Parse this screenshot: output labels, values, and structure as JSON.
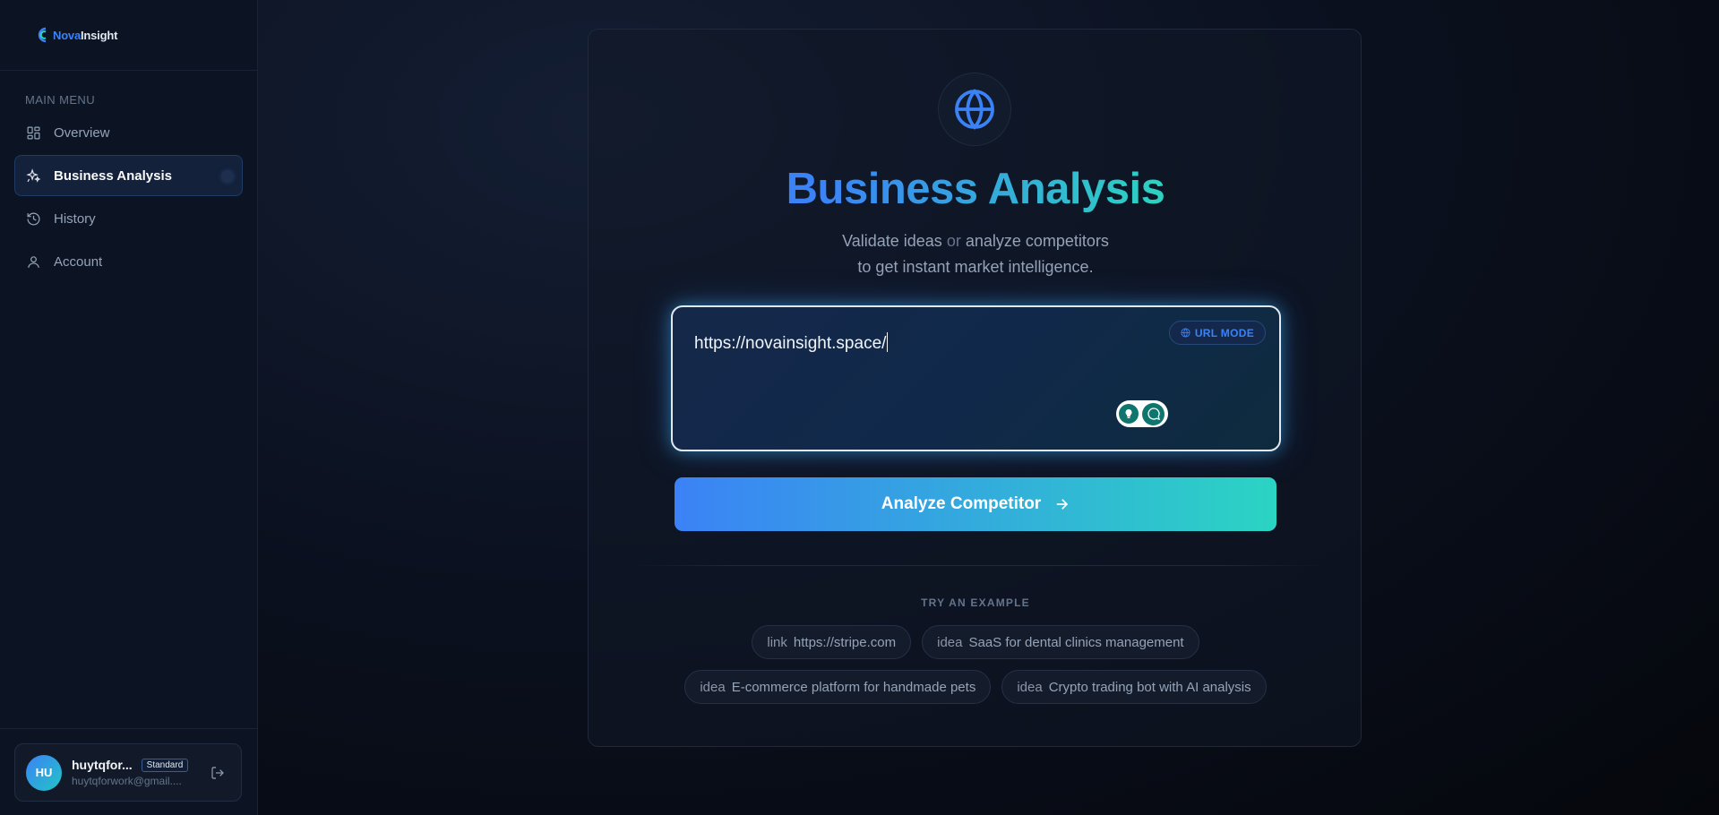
{
  "brand": {
    "name_part1": "Nova",
    "name_part2": "Insight"
  },
  "sidebar": {
    "menu_title": "MAIN MENU",
    "items": [
      {
        "label": "Overview",
        "icon": "grid-icon",
        "active": false
      },
      {
        "label": "Business Analysis",
        "icon": "sparkles-icon",
        "active": true
      },
      {
        "label": "History",
        "icon": "history-icon",
        "active": false
      },
      {
        "label": "Account",
        "icon": "user-icon",
        "active": false
      }
    ]
  },
  "user": {
    "initials": "HU",
    "name": "huytqfor...",
    "plan": "Standard",
    "email": "huytqforwork@gmail...."
  },
  "main": {
    "title": "Business Analysis",
    "subtitle_part1": "Validate ideas",
    "subtitle_or": "or",
    "subtitle_part2": "analyze competitors",
    "subtitle_line2": "to get instant market intelligence.",
    "input": {
      "value": "https://novainsight.space/",
      "mode_label": "URL MODE"
    },
    "analyze_button": "Analyze Competitor",
    "examples_title": "TRY AN EXAMPLE",
    "examples": [
      {
        "kind": "link",
        "text": "https://stripe.com"
      },
      {
        "kind": "idea",
        "text": "SaaS for dental clinics management"
      },
      {
        "kind": "idea",
        "text": "E-commerce platform for handmade pets"
      },
      {
        "kind": "idea",
        "text": "Crypto trading bot with AI analysis"
      }
    ]
  },
  "colors": {
    "accent_blue": "#3b82f6",
    "accent_teal": "#2dd4bf",
    "background": "#0b1120"
  }
}
